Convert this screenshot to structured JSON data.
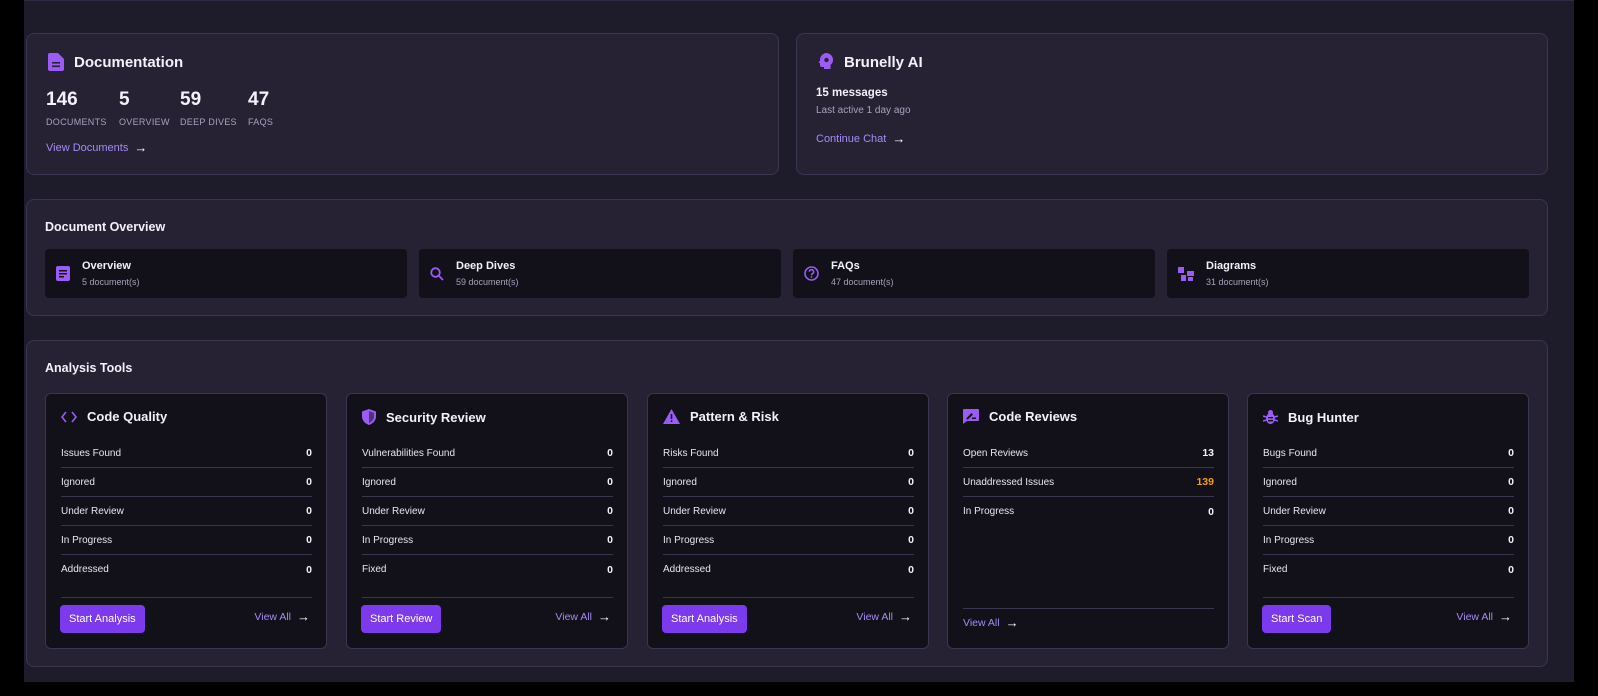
{
  "documentation": {
    "title": "Documentation",
    "stats": [
      {
        "value": "146",
        "label": "DOCUMENTS"
      },
      {
        "value": "5",
        "label": "OVERVIEW"
      },
      {
        "value": "59",
        "label": "DEEP DIVES"
      },
      {
        "value": "47",
        "label": "FAQS"
      }
    ],
    "link": "View Documents"
  },
  "ai": {
    "title": "Brunelly AI",
    "messages": "15 messages",
    "last_active": "Last active 1 day ago",
    "link": "Continue Chat"
  },
  "overview": {
    "title": "Document Overview",
    "items": [
      {
        "label": "Overview",
        "count": "5 document(s)",
        "icon": "document-icon"
      },
      {
        "label": "Deep Dives",
        "count": "59 document(s)",
        "icon": "search-icon"
      },
      {
        "label": "FAQs",
        "count": "47 document(s)",
        "icon": "help-circle-icon"
      },
      {
        "label": "Diagrams",
        "count": "31 document(s)",
        "icon": "diagram-icon"
      }
    ]
  },
  "analysis": {
    "title": "Analysis Tools",
    "tools": [
      {
        "title": "Code Quality",
        "icon": "code-icon",
        "rows": [
          {
            "label": "Issues Found",
            "value": "0"
          },
          {
            "label": "Ignored",
            "value": "0"
          },
          {
            "label": "Under Review",
            "value": "0"
          },
          {
            "label": "In Progress",
            "value": "0"
          },
          {
            "label": "Addressed",
            "value": "0"
          }
        ],
        "button": "Start Analysis",
        "link": "View All"
      },
      {
        "title": "Security Review",
        "icon": "shield-icon",
        "rows": [
          {
            "label": "Vulnerabilities Found",
            "value": "0"
          },
          {
            "label": "Ignored",
            "value": "0"
          },
          {
            "label": "Under Review",
            "value": "0"
          },
          {
            "label": "In Progress",
            "value": "0"
          },
          {
            "label": "Fixed",
            "value": "0"
          }
        ],
        "button": "Start Review",
        "link": "View All"
      },
      {
        "title": "Pattern & Risk",
        "icon": "warning-icon",
        "rows": [
          {
            "label": "Risks Found",
            "value": "0"
          },
          {
            "label": "Ignored",
            "value": "0"
          },
          {
            "label": "Under Review",
            "value": "0"
          },
          {
            "label": "In Progress",
            "value": "0"
          },
          {
            "label": "Addressed",
            "value": "0"
          }
        ],
        "button": "Start Analysis",
        "link": "View All"
      },
      {
        "title": "Code Reviews",
        "icon": "review-comment-icon",
        "rows": [
          {
            "label": "Open Reviews",
            "value": "13"
          },
          {
            "label": "Unaddressed Issues",
            "value": "139"
          },
          {
            "label": "In Progress",
            "value": "0"
          }
        ],
        "link": "View All"
      },
      {
        "title": "Bug Hunter",
        "icon": "bug-icon",
        "rows": [
          {
            "label": "Bugs Found",
            "value": "0"
          },
          {
            "label": "Ignored",
            "value": "0"
          },
          {
            "label": "Under Review",
            "value": "0"
          },
          {
            "label": "In Progress",
            "value": "0"
          },
          {
            "label": "Fixed",
            "value": "0"
          }
        ],
        "button": "Start Scan",
        "link": "View All"
      }
    ]
  },
  "colors": {
    "accent": "#7c3aed",
    "accent_text": "#a58bf4",
    "warning": "#f59e0b"
  }
}
